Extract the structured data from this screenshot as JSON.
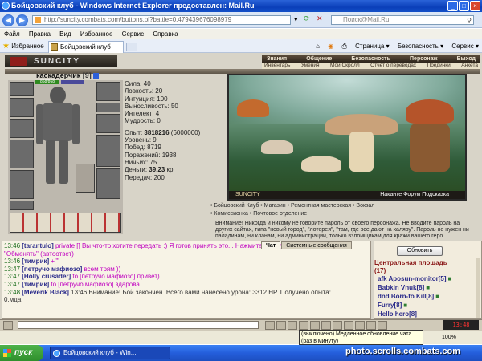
{
  "window": {
    "title": "Бойцовский клуб - Windows Internet Explorer предоставлен: Mail.Ru"
  },
  "address": {
    "url": "http://suncity.combats.com/buttons.pl?battle=0.479439676098979",
    "search_placeholder": "Поиск@Mail.Ru"
  },
  "menu": [
    "Файл",
    "Правка",
    "Вид",
    "Избранное",
    "Сервис",
    "Справка"
  ],
  "tabs": {
    "favorites_label": "Избранное",
    "tab_label": "Бойцовский клуб"
  },
  "toolbar": {
    "page": "Страница ▾",
    "security": "Безопасность ▾",
    "service": "Сервис ▾"
  },
  "game": {
    "logo_text": "SUNCITY",
    "top_nav": [
      "Знания",
      "Общение",
      "Безопасность",
      "Персонаж",
      "Выход"
    ],
    "sub_nav": [
      "Инвентарь",
      "Умения",
      "Мой Скролл",
      "Отчет о переводах",
      "Поединки",
      "Анкета"
    ],
    "char": {
      "name": "каскадерчик",
      "level": "[9]",
      "hp": "868/868"
    },
    "stats": {
      "strength": "Сила: 40",
      "agility": "Ловкость: 20",
      "intuition": "Интуиция: 100",
      "endurance": "Выносливость: 50",
      "intellect": "Интелект: 4",
      "wisdom": "Мудрость: 0",
      "exp_label": "Опыт: ",
      "exp_value": "3818216",
      "exp_next": " (6000000)",
      "level": "Уровень: 9",
      "wins": "Побед: 8719",
      "losses": "Поражений: 1938",
      "draws": "Ничьих: 75",
      "money_label": "Деньги: ",
      "money_value": "39.23",
      "money_unit": " кр.",
      "transfers": "Передач: 200"
    },
    "scene": {
      "bar_title": "SUNCITY",
      "bar_links": "Наканте Форум Подсказка"
    },
    "links": {
      "row1": "• Бойцовский Клуб   • Магазин   • Ремонтная мастерская   • Вокзал",
      "row2": "• Комиссионка   • Почтовое отделение"
    },
    "warning": "Внимание! Никогда и никому не говорите пароль от своего персонажа. Не вводите пароль на других сайтах, типа \"новый город\", \"лотерея\", \"там, где все дают на халяву\". Пароль не нужен ни паладинам, ни кланам, ни администрации, только взломщикам для кражи вашего геро...",
    "chat_tabs": [
      "Чат",
      "Системные сообщения"
    ],
    "chat": [
      {
        "time": "13:46",
        "name": "[tarantulo]",
        "text": " private [] Вы что-то хотите передать :) Я готов принять это... Нажмите кнопку"
      },
      {
        "time": "",
        "name": "",
        "text": "\"Обменять\" (автоответ)"
      },
      {
        "time": "13:46",
        "name": "[тимрик]",
        "text": " +\"\""
      },
      {
        "time": "13:47",
        "name": "[петручо мафиозо]",
        "text": " всем трям ))"
      },
      {
        "time": "13:47",
        "name": "[Holly crusader]",
        "text": " to [петручо мафиозо] привет)"
      },
      {
        "time": "13:47",
        "name": "[тимрик]",
        "text": " to [петручо мафиозо] здарова"
      },
      {
        "time": "13:48",
        "name": "[Meverik Black]",
        "text": " 13:46 Внимание! Бой закончен. Всего вами нанесено урона: 3312 HP. Получено опыта:"
      },
      {
        "time": "",
        "name": "",
        "text": "0.мда"
      }
    ],
    "right_panel": {
      "refresh_label": "Обновить",
      "place": "Центральная площадь",
      "count": "(17)",
      "users": [
        "afk Aposun-monitor[5]",
        "Babkin Vnuk[8]",
        "dnd Born-to Kill[8]",
        "Furry[8]",
        "Hello hero[8]"
      ]
    },
    "clock": "13:48"
  },
  "tooltip": "(выключено) Медленное обновление чата (раз в минуту)",
  "statusbar": {
    "zoom": "100%"
  },
  "taskbar": {
    "start": "пуск",
    "item": "Бойцовский клуб - Win..."
  },
  "watermark": "photo.scrolls.combats.com"
}
